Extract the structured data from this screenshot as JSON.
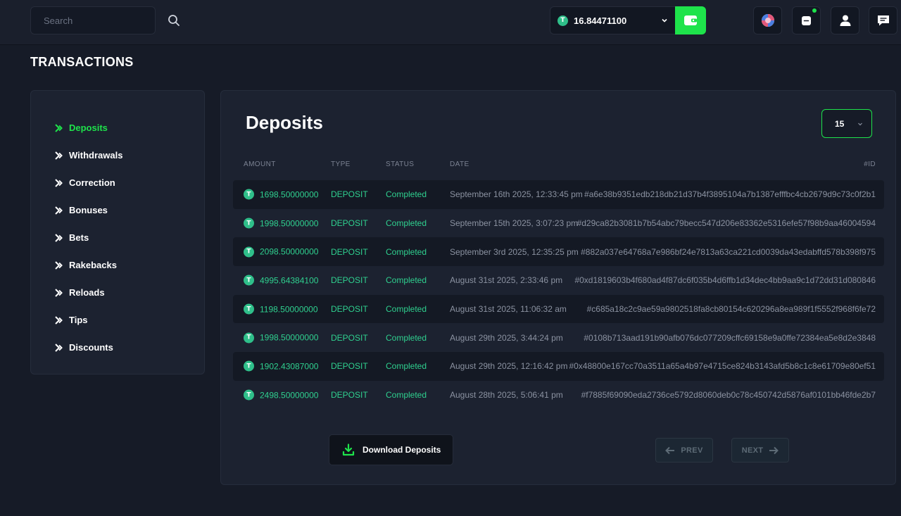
{
  "search": {
    "placeholder": "Search"
  },
  "balance": {
    "amount": "16.84471100",
    "coin_symbol": "T"
  },
  "page_title": "TRANSACTIONS",
  "sidebar": {
    "items": [
      {
        "label": "Deposits",
        "active": true
      },
      {
        "label": "Withdrawals"
      },
      {
        "label": "Correction"
      },
      {
        "label": "Bonuses"
      },
      {
        "label": "Bets"
      },
      {
        "label": "Rakebacks"
      },
      {
        "label": "Reloads"
      },
      {
        "label": "Tips"
      },
      {
        "label": "Discounts"
      }
    ]
  },
  "main": {
    "title": "Deposits",
    "page_size": "15",
    "columns": {
      "amount": "AMOUNT",
      "type": "TYPE",
      "status": "STATUS",
      "date": "DATE",
      "id": "#ID"
    },
    "rows": [
      {
        "amount": "1698.50000000",
        "type": "DEPOSIT",
        "status": "Completed",
        "date": "September 16th 2025, 12:33:45 pm",
        "id": "#a6e38b9351edb218db21d37b4f3895104a7b1387efffbc4cb2679d9c73c0f2b1"
      },
      {
        "amount": "1998.50000000",
        "type": "DEPOSIT",
        "status": "Completed",
        "date": "September 15th 2025, 3:07:23 pm",
        "id": "#d29ca82b3081b7b54abc79becc547d206e83362e5316efe57f98b9aa46004594"
      },
      {
        "amount": "2098.50000000",
        "type": "DEPOSIT",
        "status": "Completed",
        "date": "September 3rd 2025, 12:35:25 pm",
        "id": "#882a037e64768a7e986bf24e7813a63ca221cd0039da43edabffd578b398f975"
      },
      {
        "amount": "4995.64384100",
        "type": "DEPOSIT",
        "status": "Completed",
        "date": "August 31st 2025, 2:33:46 pm",
        "id": "#0xd1819603b4f680ad4f87dc6f035b4d6ffb1d34dec4bb9aa9c1d72dd31d080846"
      },
      {
        "amount": "1198.50000000",
        "type": "DEPOSIT",
        "status": "Completed",
        "date": "August 31st 2025, 11:06:32 am",
        "id": "#c685a18c2c9ae59a9802518fa8cb80154c620296a8ea989f1f5552f968f6fe72"
      },
      {
        "amount": "1998.50000000",
        "type": "DEPOSIT",
        "status": "Completed",
        "date": "August 29th 2025, 3:44:24 pm",
        "id": "#0108b713aad191b90afb076dc077209cffc69158e9a0ffe72384ea5e8d2e3848"
      },
      {
        "amount": "1902.43087000",
        "type": "DEPOSIT",
        "status": "Completed",
        "date": "August 29th 2025, 12:16:42 pm",
        "id": "#0x48800e167cc70a3511a65a4b97e4715ce824b3143afd5b8c1c8e61709e80ef51"
      },
      {
        "amount": "2498.50000000",
        "type": "DEPOSIT",
        "status": "Completed",
        "date": "August 28th 2025, 5:06:41 pm",
        "id": "#f7885f69090eda2736ce5792d8060deb0c78c450742d5876af0101bb46fde2b7"
      }
    ],
    "download_label": "Download Deposits",
    "prev_label": "PREV",
    "next_label": "NEXT"
  },
  "colors": {
    "accent": "#1ee34b",
    "positive": "#2fd08f",
    "coin": "#2fbf8a",
    "background": "#161b27",
    "panel": "#1c2230"
  },
  "icons": {
    "search": "search-icon",
    "chevron": "chevron-down-icon",
    "wallet": "wallet-icon",
    "globe": "globe-icon",
    "notification": "notification-icon",
    "user": "user-icon",
    "chat": "chat-icon",
    "sidebar_arrow": "double-chevron-right-icon",
    "download": "download-icon",
    "prev": "arrow-left-icon",
    "next": "arrow-right-icon",
    "coin": "tether-coin-icon"
  }
}
